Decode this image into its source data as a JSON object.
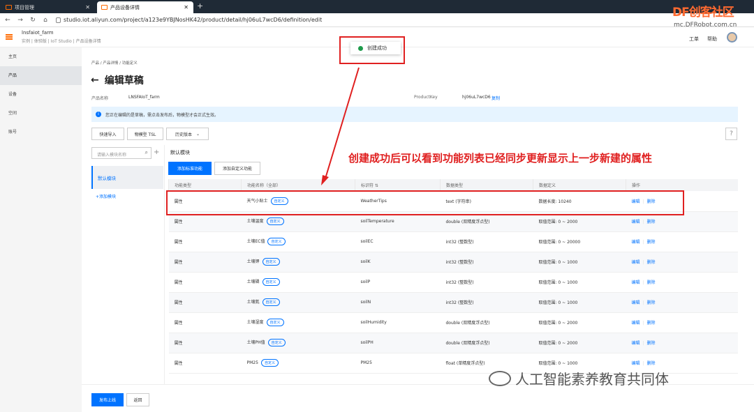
{
  "browser": {
    "tabs": [
      {
        "label": "项目管理"
      },
      {
        "label": "产品设备详情"
      }
    ],
    "url": "studio.iot.aliyun.com/project/a123e9YBJNosHK42/product/detail/hj06uL7wcD6/definition/edit"
  },
  "logo": {
    "main": "DF创客社区",
    "sub": "mc.DFRobot.com.cn"
  },
  "header": {
    "instance": "lnsfaiot_farm",
    "breadcrumb": "实例 | 体验版 | IoT Studio | 产品设备详情",
    "links": [
      "工单",
      "帮助"
    ]
  },
  "sidebar": {
    "items": [
      "主页",
      "产品",
      "设备",
      "空间",
      "账号"
    ]
  },
  "toast": {
    "text": "创建成功"
  },
  "page": {
    "breadcrumb": "产品  /  产品详情  /  功能定义",
    "title": "编辑草稿",
    "product_name_label": "产品名称",
    "product_name": "LNSFAIoT_farm",
    "product_key_label": "ProductKey",
    "product_key": "hj06uL7wcD6",
    "copy": "复制",
    "info": "您正在编辑的是草稿，需点击发布后，物模型才会正式生效。"
  },
  "toolbar": {
    "quick_import": "快速导入",
    "tsl": "物模型 TSL",
    "history": "历史版本",
    "help": "?"
  },
  "modules": {
    "search_placeholder": "请输入模块名称",
    "default": "默认模块",
    "add": "+添加模块",
    "title": "默认模块",
    "add_std": "添加标准功能",
    "add_custom": "添加自定义功能"
  },
  "table": {
    "headers": [
      "功能类型",
      "功能名称（全部）",
      "标识符 ⇅",
      "数据类型",
      "数据定义",
      "操作"
    ],
    "rows": [
      {
        "type": "属性",
        "name": "天气小贴士",
        "tag": "自定义",
        "id": "WeatherTips",
        "dtype": "text (字符串)",
        "def": "数据长度: 10240"
      },
      {
        "type": "属性",
        "name": "土壤温度",
        "tag": "自定义",
        "id": "soilTemperature",
        "dtype": "double (双精度浮点型)",
        "def": "取值范围: 0 ~ 2000"
      },
      {
        "type": "属性",
        "name": "土壤EC值",
        "tag": "自定义",
        "id": "soilEC",
        "dtype": "int32 (整数型)",
        "def": "取值范围: 0 ~ 20000"
      },
      {
        "type": "属性",
        "name": "土壤钾",
        "tag": "自定义",
        "id": "soilK",
        "dtype": "int32 (整数型)",
        "def": "取值范围: 0 ~ 1000"
      },
      {
        "type": "属性",
        "name": "土壤磷",
        "tag": "自定义",
        "id": "soilP",
        "dtype": "int32 (整数型)",
        "def": "取值范围: 0 ~ 1000"
      },
      {
        "type": "属性",
        "name": "土壤氮",
        "tag": "自定义",
        "id": "soilN",
        "dtype": "int32 (整数型)",
        "def": "取值范围: 0 ~ 1000"
      },
      {
        "type": "属性",
        "name": "土壤湿度",
        "tag": "自定义",
        "id": "soilHumidity",
        "dtype": "double (双精度浮点型)",
        "def": "取值范围: 0 ~ 2000"
      },
      {
        "type": "属性",
        "name": "土壤PH值",
        "tag": "自定义",
        "id": "soilPH",
        "dtype": "double (双精度浮点型)",
        "def": "取值范围: 0 ~ 2000"
      },
      {
        "type": "属性",
        "name": "PM25",
        "tag": "自定义",
        "id": "PM25",
        "dtype": "float (单精度浮点型)",
        "def": "取值范围: 0 ~ 1000"
      }
    ],
    "edit": "编辑",
    "delete": "删除"
  },
  "annotation": "创建成功后可以看到功能列表已经同步更新显示上一步新建的属性",
  "footer": {
    "publish": "发布上线",
    "back": "返回"
  },
  "watermark": "人工智能素养教育共同体"
}
